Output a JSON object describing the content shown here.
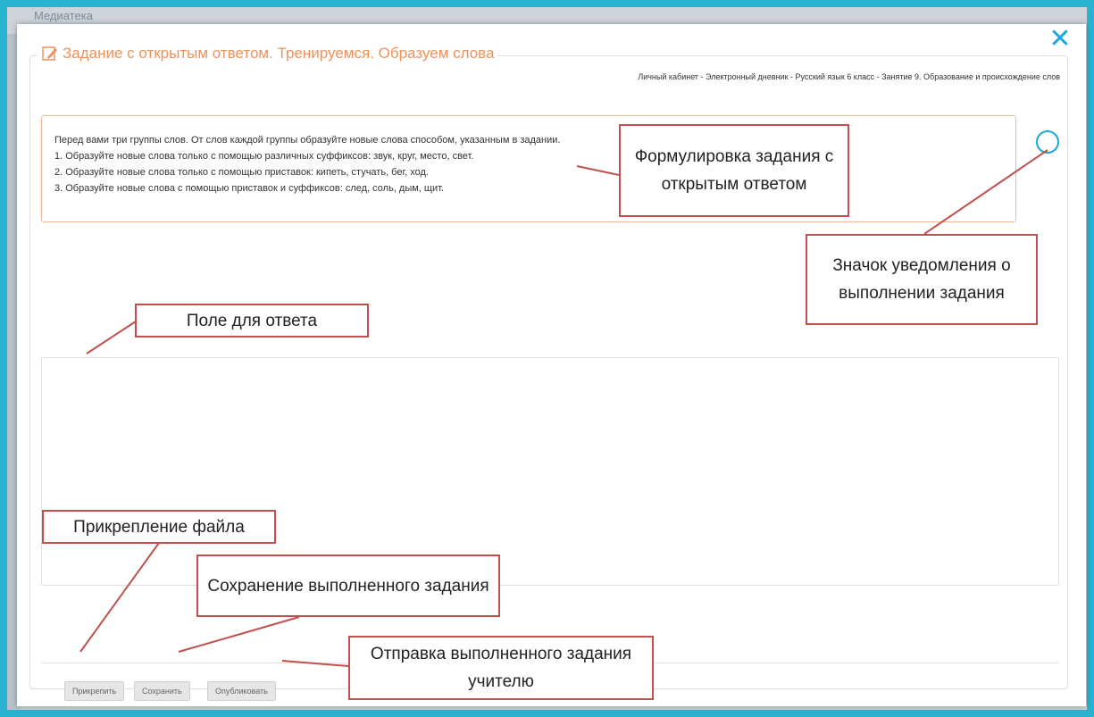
{
  "backdrop": {
    "text": "Медиатека"
  },
  "modal": {
    "close_label": "✕",
    "title": "Задание с открытым ответом. Тренируемся. Образуем слова",
    "breadcrumb": "Личный кабинет - Электронный дневник - Русский язык 6 класс - Занятие 9. Образование и происхождение слов",
    "task_lines": [
      "Перед вами три группы слов. От слов каждой группы образуйте новые слова способом, указанным в задании.",
      "1. Образуйте новые слова только с помощью различных суффиксов: звук, круг, место, свет.",
      "2. Образуйте новые слова только с помощью приставок: кипеть, стучать, бег, ход.",
      "3. Образуйте новые слова с помощью приставок и суффиксов: след, соль, дым, щит."
    ],
    "answer_value": "",
    "buttons": {
      "attach": "Прикрепить",
      "save": "Сохранить",
      "publish": "Опубликовать"
    }
  },
  "callouts": {
    "task_wording": "Формулировка задания с открытым ответом",
    "notification_icon": "Значок уведомления о выполнении задания",
    "answer_field": "Поле для ответа",
    "attach_file": "Прикрепление файла",
    "save_task": "Сохранение выполненного задания",
    "send_task": "Отправка выполненного задания учителю"
  },
  "colors": {
    "accent": "#f0915a",
    "close": "#1aa6e0",
    "callout_border": "#c0504d",
    "frame": "#2ab3d1"
  },
  "icons": {
    "title_icon": "pencil-icon",
    "close_icon": "close-icon",
    "status_icon": "circle-status-icon"
  }
}
